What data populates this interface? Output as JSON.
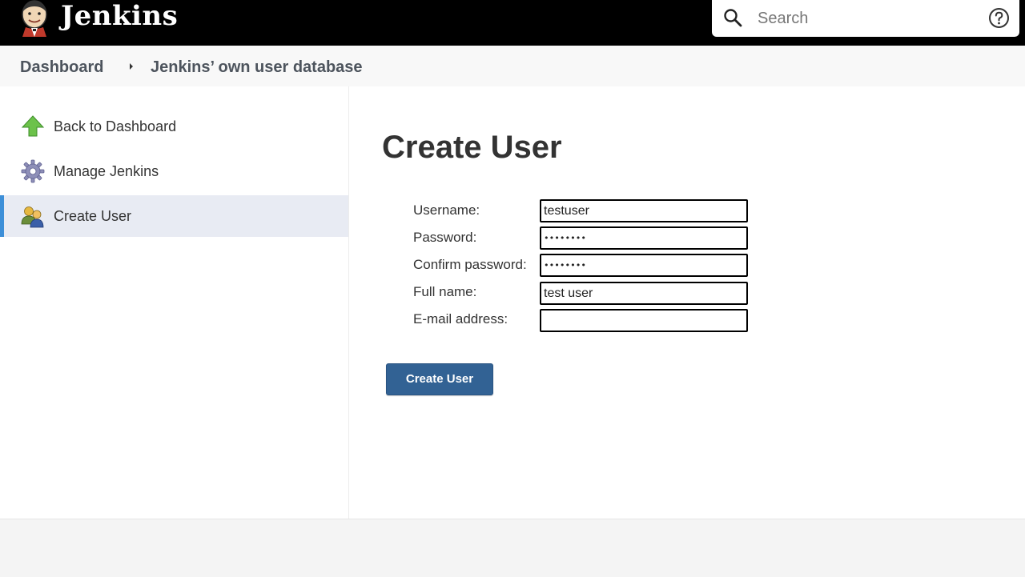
{
  "header": {
    "brand": "Jenkins",
    "logo_icon": "jenkins-butler-icon",
    "search_placeholder": "Search",
    "search_icon": "search-icon",
    "help_icon": "help-icon"
  },
  "breadcrumb": {
    "items": [
      {
        "label": "Dashboard"
      },
      {
        "label": "Jenkins’ own user database"
      }
    ],
    "separator_icon": "chevron-right-icon"
  },
  "sidebar": {
    "items": [
      {
        "label": "Back to Dashboard",
        "icon": "up-arrow-icon",
        "active": false
      },
      {
        "label": "Manage Jenkins",
        "icon": "gear-icon",
        "active": false
      },
      {
        "label": "Create User",
        "icon": "user-group-icon",
        "active": true
      }
    ]
  },
  "main": {
    "title": "Create User",
    "form": {
      "fields": [
        {
          "label": "Username:",
          "value": "testuser",
          "type": "text"
        },
        {
          "label": "Password:",
          "value": "testuser",
          "type": "password"
        },
        {
          "label": "Confirm password:",
          "value": "testuser",
          "type": "password"
        },
        {
          "label": "Full name:",
          "value": "test user",
          "type": "text"
        },
        {
          "label": "E-mail address:",
          "value": "",
          "type": "email"
        }
      ],
      "submit_label": "Create User"
    }
  },
  "colors": {
    "header_bg": "#000000",
    "active_accent": "#3d8fd8",
    "button_bg": "#326294"
  }
}
